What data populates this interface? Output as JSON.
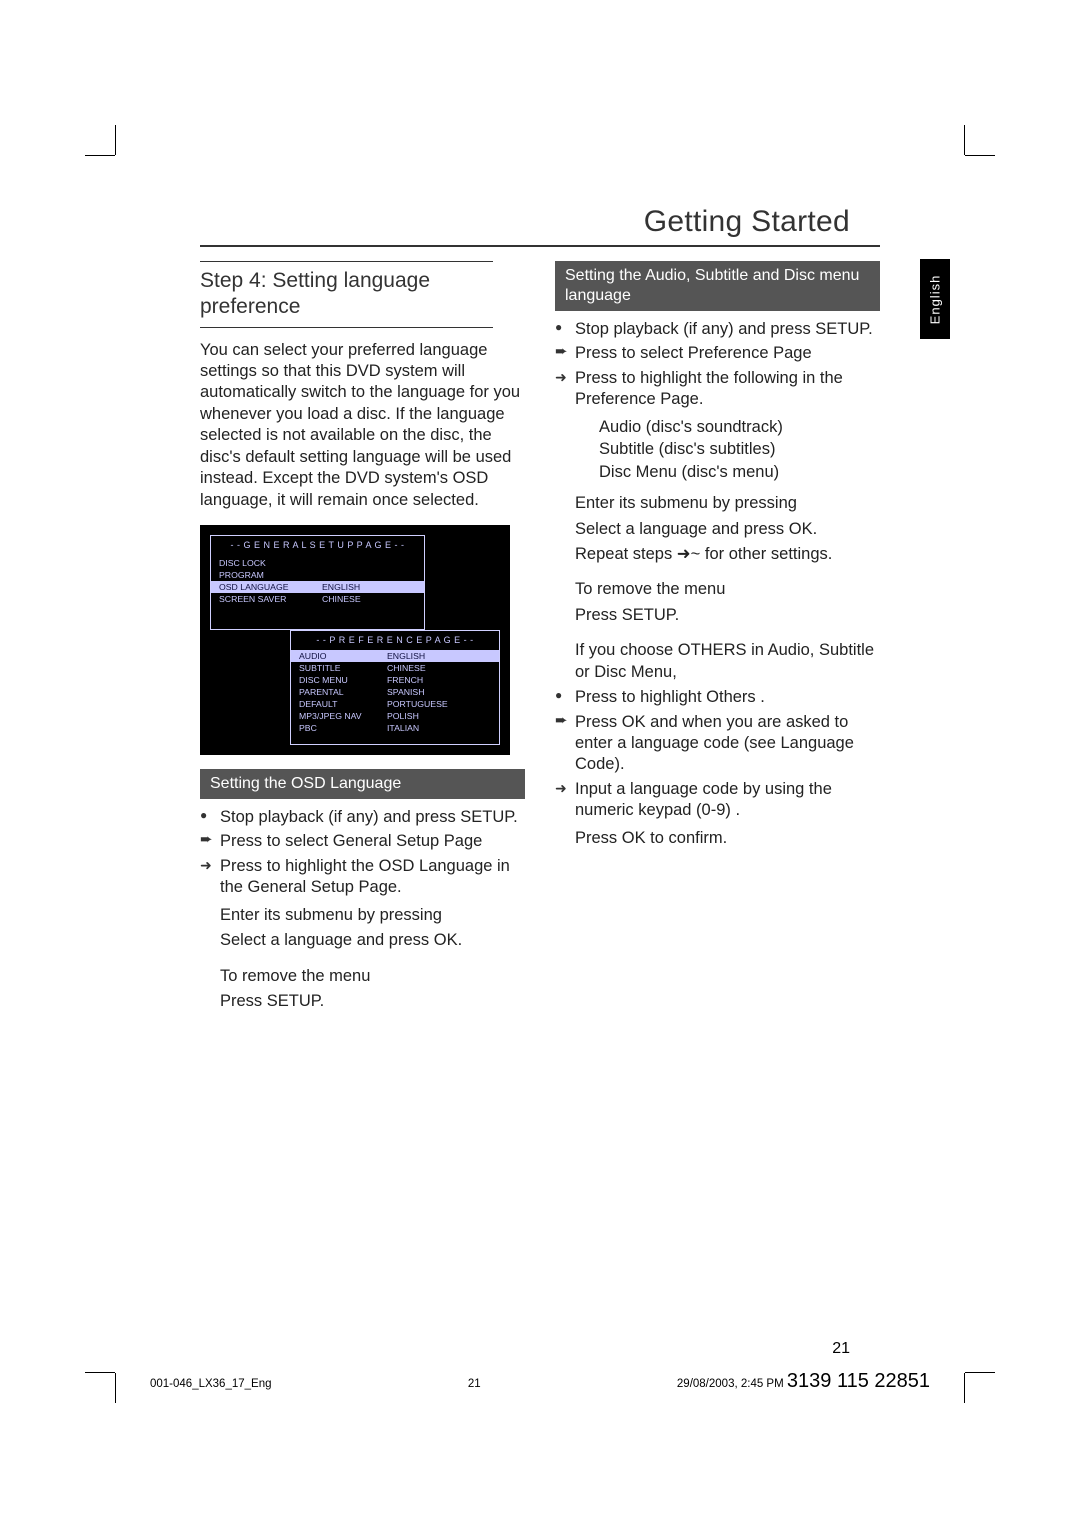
{
  "chapter_title": "Getting Started",
  "side_tab_label": "English",
  "left": {
    "heading": "Step 4: Setting language preference",
    "intro": "You can select your preferred language settings so that this DVD system will automatically switch to the language for you whenever you load a disc.  If the language selected is not available on the disc, the disc's default setting language will be used instead.  Except the DVD system's OSD language, it will remain once selected.",
    "subhead": "Setting the OSD Language",
    "steps": {
      "s1": "Stop playback (if any) and press SETUP.",
      "s2": "Press  to select General Setup Page",
      "s3": "Press  to highlight the OSD Language in the General Setup Page.",
      "s4": "Enter its submenu by pressing",
      "s5": "Select a language and press OK.",
      "s6a": "To remove the menu",
      "s6b": "Press SETUP."
    },
    "osd": {
      "top_title": "- -   G E N E R A L   S E T U P   P A G E   - -",
      "top_rows": [
        [
          "DISC LOCK",
          ""
        ],
        [
          "PROGRAM",
          ""
        ],
        [
          "OSD LANGUAGE",
          "ENGLISH"
        ],
        [
          "SCREEN SAVER",
          "CHINESE"
        ]
      ],
      "bottom_title": "- -   P R E F E R E N C E   P A G E   - -",
      "bottom_rows": [
        [
          "AUDIO",
          "ENGLISH"
        ],
        [
          "SUBTITLE",
          "CHINESE"
        ],
        [
          "DISC MENU",
          "FRENCH"
        ],
        [
          "PARENTAL",
          "SPANISH"
        ],
        [
          "DEFAULT",
          "PORTUGUESE"
        ],
        [
          "MP3/JPEG NAV",
          "POLISH"
        ],
        [
          "PBC",
          "ITALIAN"
        ]
      ]
    }
  },
  "right": {
    "subhead": "Setting the Audio, Subtitle and Disc menu language",
    "steps": {
      "s1": "Stop playback (if any) and press SETUP.",
      "s2": "Press  to select Preference Page",
      "s3": "Press  to highlight the following in the Preference Page."
    },
    "indent": {
      "audio": "Audio (disc's soundtrack)",
      "subtitle": "Subtitle (disc's subtitles)",
      "discmenu": "Disc Menu (disc's menu)"
    },
    "steps2": {
      "s4": "Enter its submenu by pressing",
      "s5": "Select a language and press OK.",
      "s6": "Repeat steps ➜~   for other settings.",
      "s7a": "To remove the menu",
      "s7b": "Press SETUP."
    },
    "others_note": "If you choose OTHERS in Audio, Subtitle or Disc Menu,",
    "others": {
      "o1": "Press  to highlight Others .",
      "o2": "Press OK and when you are asked to enter a language code (see Language Code).",
      "o3": "Input a language code by using the numeric keypad (0-9) .",
      "o4": "Press OK to confirm."
    }
  },
  "page_number": "21",
  "footer": {
    "file": "001-046_LX36_17_Eng",
    "folio": "21",
    "timestamp": "29/08/2003, 2:45 PM",
    "partno": "3139 115 22851"
  }
}
